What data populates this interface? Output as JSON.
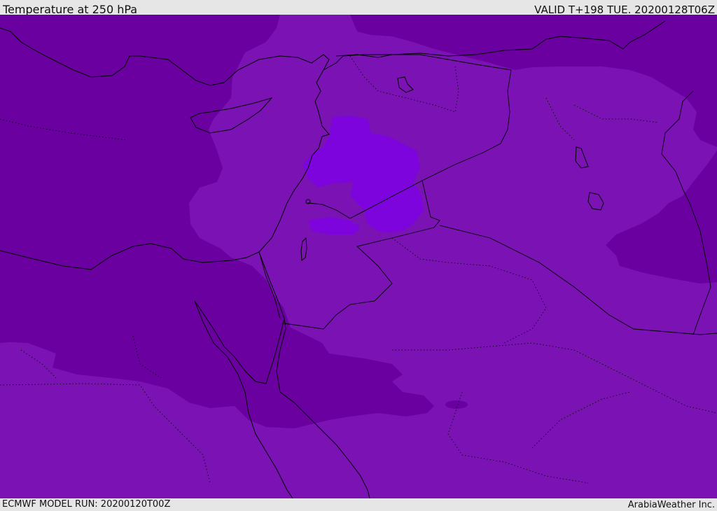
{
  "header": {
    "title": "Temperature at 250 hPa",
    "valid": "VALID T+198 TUE. 20200128T06Z"
  },
  "footer": {
    "model_run": "ECMWF MODEL RUN: 20200120T00Z",
    "credit": "ArabiaWeather Inc."
  },
  "colors": {
    "cold_band": "#6a00a0",
    "mid_band": "#7a12b4",
    "warm_band": "#7d04dc",
    "coastline": "#000000",
    "border": "#000000",
    "bar_background": "#e6e6e6"
  }
}
